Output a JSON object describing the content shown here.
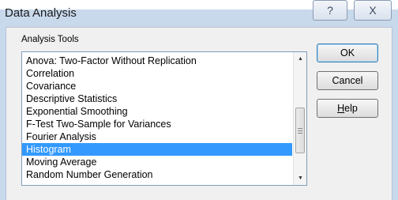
{
  "window": {
    "title": "Data Analysis",
    "help_button": "?",
    "close_button": "X"
  },
  "group": {
    "label": "Analysis Tools"
  },
  "list": {
    "items": [
      "Anova: Two-Factor Without Replication",
      "Correlation",
      "Covariance",
      "Descriptive Statistics",
      "Exponential Smoothing",
      "F-Test Two-Sample for Variances",
      "Fourier Analysis",
      "Histogram",
      "Moving Average",
      "Random Number Generation"
    ],
    "selected": "Histogram"
  },
  "buttons": {
    "ok": "OK",
    "cancel": "Cancel",
    "help": "Help"
  },
  "scrollbar": {
    "up_arrow": "▲",
    "down_arrow": "▼"
  }
}
